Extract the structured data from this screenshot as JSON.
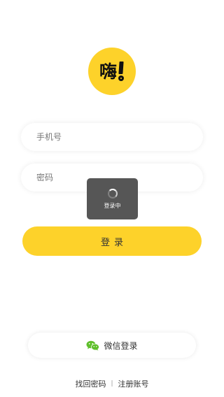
{
  "logo": {
    "text": "嗨",
    "color": "#fdd22a"
  },
  "form": {
    "phone_placeholder": "手机号",
    "password_placeholder": "密码",
    "login_label": "登录"
  },
  "loading": {
    "text": "登录中"
  },
  "wechat": {
    "label": "微信登录",
    "icon": "wechat-icon",
    "color": "#5fbf2b"
  },
  "links": {
    "find_password": "找回密码",
    "separator": "|",
    "register": "注册账号"
  },
  "colors": {
    "accent": "#fdd22a",
    "toast_bg": "#484848"
  }
}
